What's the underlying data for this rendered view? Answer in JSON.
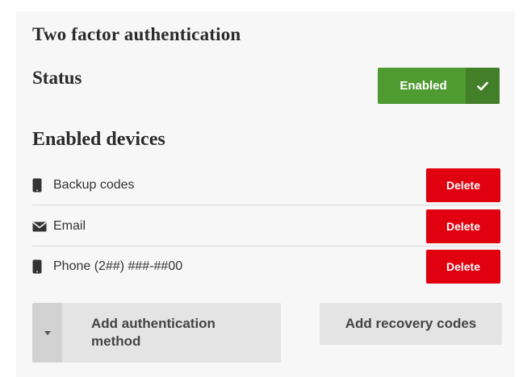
{
  "header": {
    "title": "Two factor authentication"
  },
  "status": {
    "label": "Status",
    "button_label": "Enabled",
    "button_color": "#4f9a31",
    "icon": "check-icon"
  },
  "devices": {
    "section_title": "Enabled devices",
    "items": [
      {
        "label": "Backup codes",
        "icon": "phone-icon",
        "delete_label": "Delete"
      },
      {
        "label": "Email",
        "icon": "envelope-icon",
        "delete_label": "Delete"
      },
      {
        "label": "Phone (2##) ###-##00",
        "icon": "phone-icon",
        "delete_label": "Delete"
      }
    ],
    "delete_color": "#e1000f"
  },
  "actions": {
    "add_method_label": "Add authentication method",
    "add_recovery_label": "Add recovery codes"
  }
}
